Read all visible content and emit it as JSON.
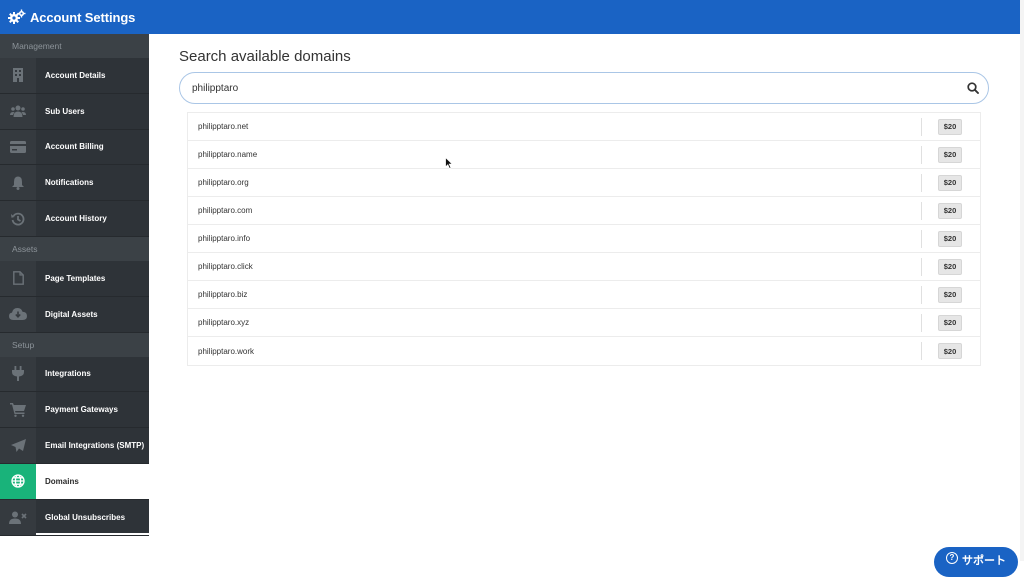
{
  "header": {
    "title": "Account Settings",
    "icon": "gears-icon",
    "color": "#1a63c4"
  },
  "sidebar": {
    "sections": [
      {
        "label": "Management",
        "items": [
          {
            "label": "Account Details",
            "icon": "building-icon"
          },
          {
            "label": "Sub Users",
            "icon": "users-icon"
          },
          {
            "label": "Account Billing",
            "icon": "credit-card-icon"
          },
          {
            "label": "Notifications",
            "icon": "bell-icon"
          },
          {
            "label": "Account History",
            "icon": "history-icon"
          }
        ]
      },
      {
        "label": "Assets",
        "items": [
          {
            "label": "Page Templates",
            "icon": "file-icon"
          },
          {
            "label": "Digital Assets",
            "icon": "cloud-download-icon"
          }
        ]
      },
      {
        "label": "Setup",
        "items": [
          {
            "label": "Integrations",
            "icon": "plug-icon"
          },
          {
            "label": "Payment Gateways",
            "icon": "cart-icon"
          },
          {
            "label": "Email Integrations (SMTP)",
            "icon": "paper-plane-icon"
          },
          {
            "label": "Domains",
            "icon": "globe-icon",
            "active": true
          },
          {
            "label": "Global Unsubscribes",
            "icon": "user-times-icon"
          }
        ]
      }
    ],
    "active_color": "#19b37a"
  },
  "main": {
    "title": "Search available domains",
    "search": {
      "value": "philipptaro",
      "icon": "search-icon"
    },
    "results": [
      {
        "domain": "philipptaro.net",
        "price": "$20"
      },
      {
        "domain": "philipptaro.name",
        "price": "$20"
      },
      {
        "domain": "philipptaro.org",
        "price": "$20"
      },
      {
        "domain": "philipptaro.com",
        "price": "$20"
      },
      {
        "domain": "philipptaro.info",
        "price": "$20"
      },
      {
        "domain": "philipptaro.click",
        "price": "$20"
      },
      {
        "domain": "philipptaro.biz",
        "price": "$20"
      },
      {
        "domain": "philipptaro.xyz",
        "price": "$20"
      },
      {
        "domain": "philipptaro.work",
        "price": "$20"
      }
    ]
  },
  "support": {
    "label": "サポート",
    "icon": "question-circle-icon"
  }
}
